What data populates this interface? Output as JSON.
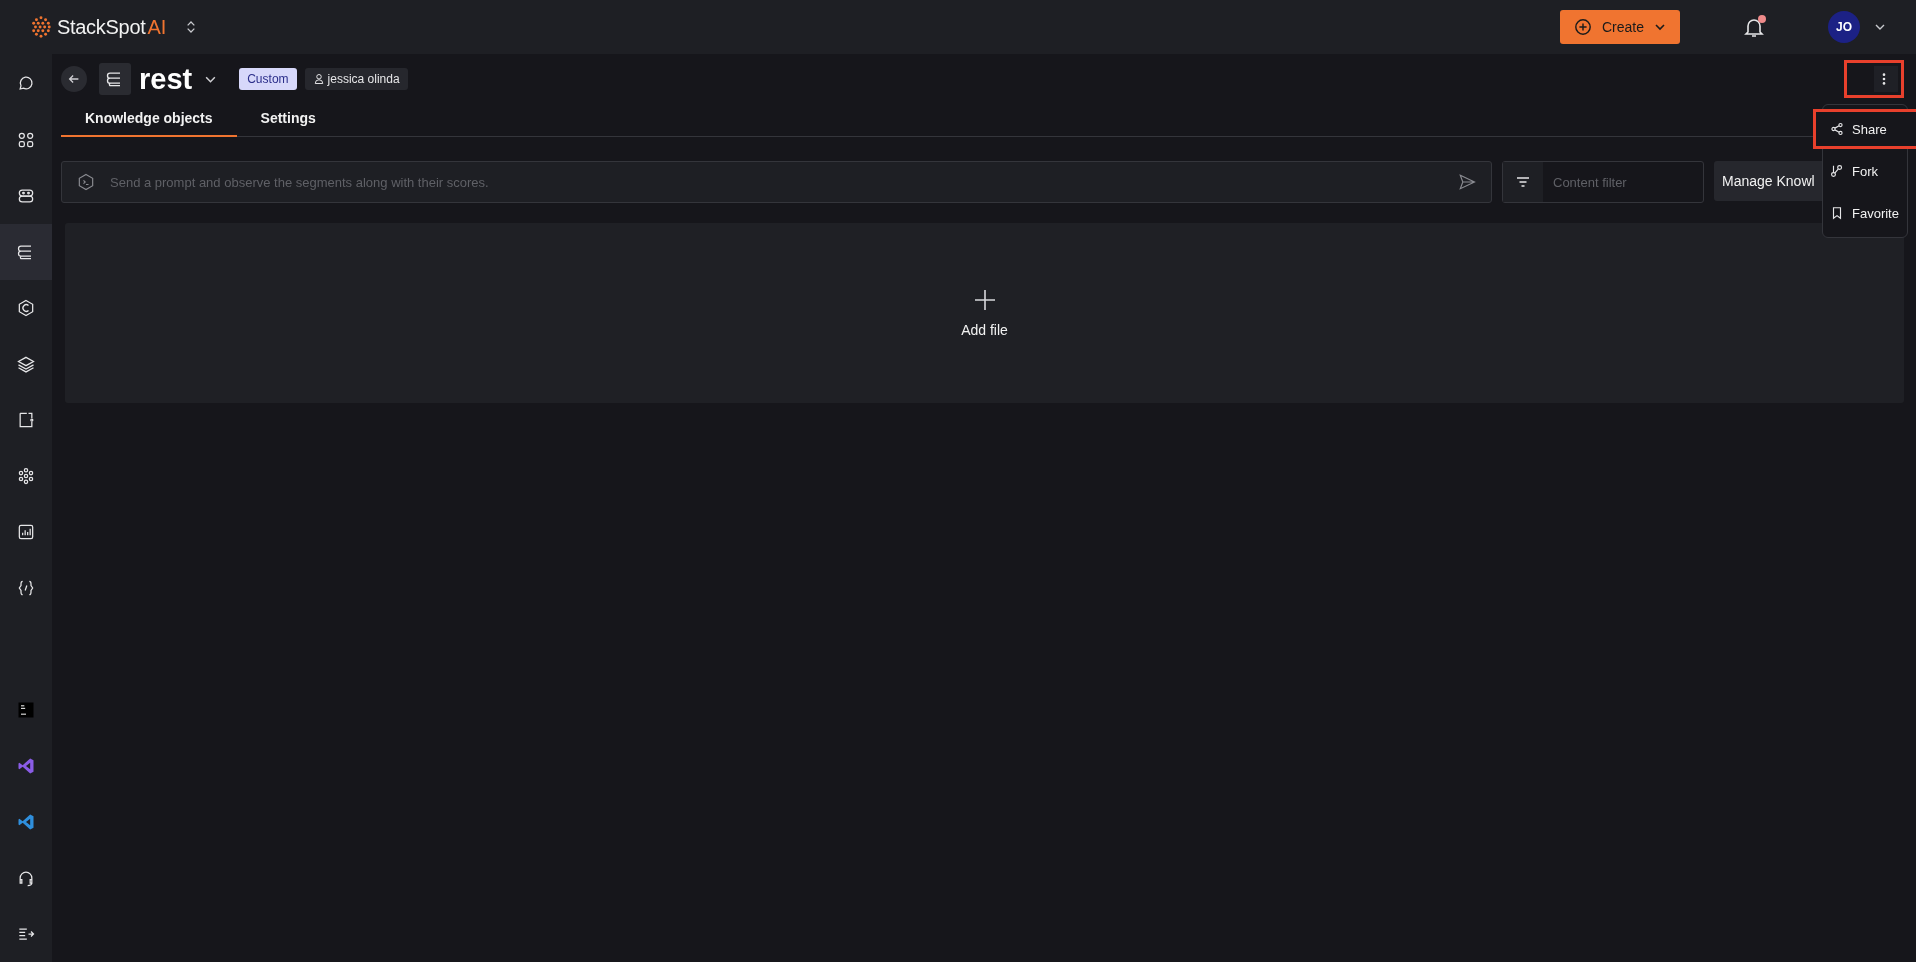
{
  "header": {
    "brand": "StackSpot",
    "brand_suffix": "AI",
    "create_button": "Create",
    "notification_unread": true,
    "avatar": "JO"
  },
  "sidebar": {
    "items": [
      {
        "kind": "chat",
        "selected": false
      },
      {
        "kind": "grid",
        "selected": false
      },
      {
        "kind": "bot",
        "selected": false
      },
      {
        "kind": "stack",
        "selected": true
      },
      {
        "kind": "shield",
        "selected": false
      },
      {
        "kind": "layers",
        "selected": false
      },
      {
        "kind": "clipboard",
        "selected": false
      },
      {
        "kind": "flower",
        "selected": false
      },
      {
        "kind": "chart",
        "selected": false
      },
      {
        "kind": "braces",
        "selected": false
      }
    ],
    "bottom_items": [
      {
        "kind": "jetbrains",
        "selected": false
      },
      {
        "kind": "vs",
        "selected": false
      },
      {
        "kind": "vscode",
        "selected": false
      },
      {
        "kind": "headset",
        "selected": false
      },
      {
        "kind": "collapse",
        "selected": false
      }
    ]
  },
  "page": {
    "title": "rest",
    "badge": "Custom",
    "owner": "jessica olinda",
    "more_highlighted": true
  },
  "tabs": [
    {
      "label": "Knowledge objects",
      "selected": true
    },
    {
      "label": "Settings",
      "selected": false
    }
  ],
  "prompt": {
    "placeholder": "Send a prompt and observe the segments along with their scores."
  },
  "filter": {
    "placeholder": "Content filter"
  },
  "manage_button": "Manage Knowl",
  "menu": [
    {
      "kind": "share",
      "label": "Share",
      "highlighted": true
    },
    {
      "kind": "fork",
      "label": "Fork",
      "highlighted": false
    },
    {
      "kind": "favorite",
      "label": "Favorite",
      "highlighted": false
    }
  ],
  "dropzone": {
    "label": "Add file"
  }
}
